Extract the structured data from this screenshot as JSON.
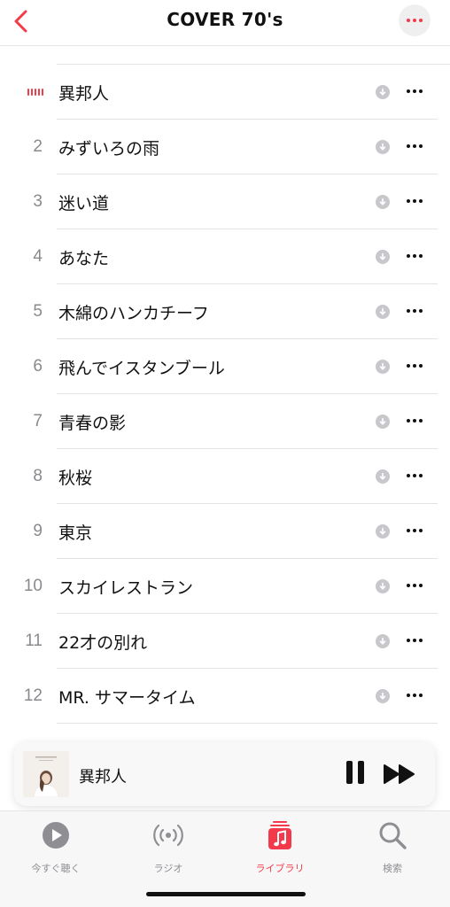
{
  "header": {
    "title": "COVER 70's"
  },
  "tracks": [
    {
      "number": "",
      "title": "異邦人",
      "now_playing": true
    },
    {
      "number": "2",
      "title": "みずいろの雨"
    },
    {
      "number": "3",
      "title": "迷い道"
    },
    {
      "number": "4",
      "title": "あなた"
    },
    {
      "number": "5",
      "title": "木綿のハンカチーフ"
    },
    {
      "number": "6",
      "title": "飛んでイスタンブール"
    },
    {
      "number": "7",
      "title": "青春の影"
    },
    {
      "number": "8",
      "title": "秋桜"
    },
    {
      "number": "9",
      "title": "東京"
    },
    {
      "number": "10",
      "title": "スカイレストラン"
    },
    {
      "number": "11",
      "title": "22才の別れ"
    },
    {
      "number": "12",
      "title": "MR. サマータイム"
    }
  ],
  "mini_player": {
    "song": "異邦人",
    "artwork_icon": "album-artwork"
  },
  "tabs": [
    {
      "label": "今すぐ聴く",
      "icon": "play-circle-icon"
    },
    {
      "label": "ラジオ",
      "icon": "radio-icon"
    },
    {
      "label": "ライブラリ",
      "icon": "library-music-icon",
      "active": true
    },
    {
      "label": "検索",
      "icon": "search-icon"
    }
  ],
  "colors": {
    "accent": "#f33a4a",
    "secondary_text": "#8a8a8e"
  }
}
